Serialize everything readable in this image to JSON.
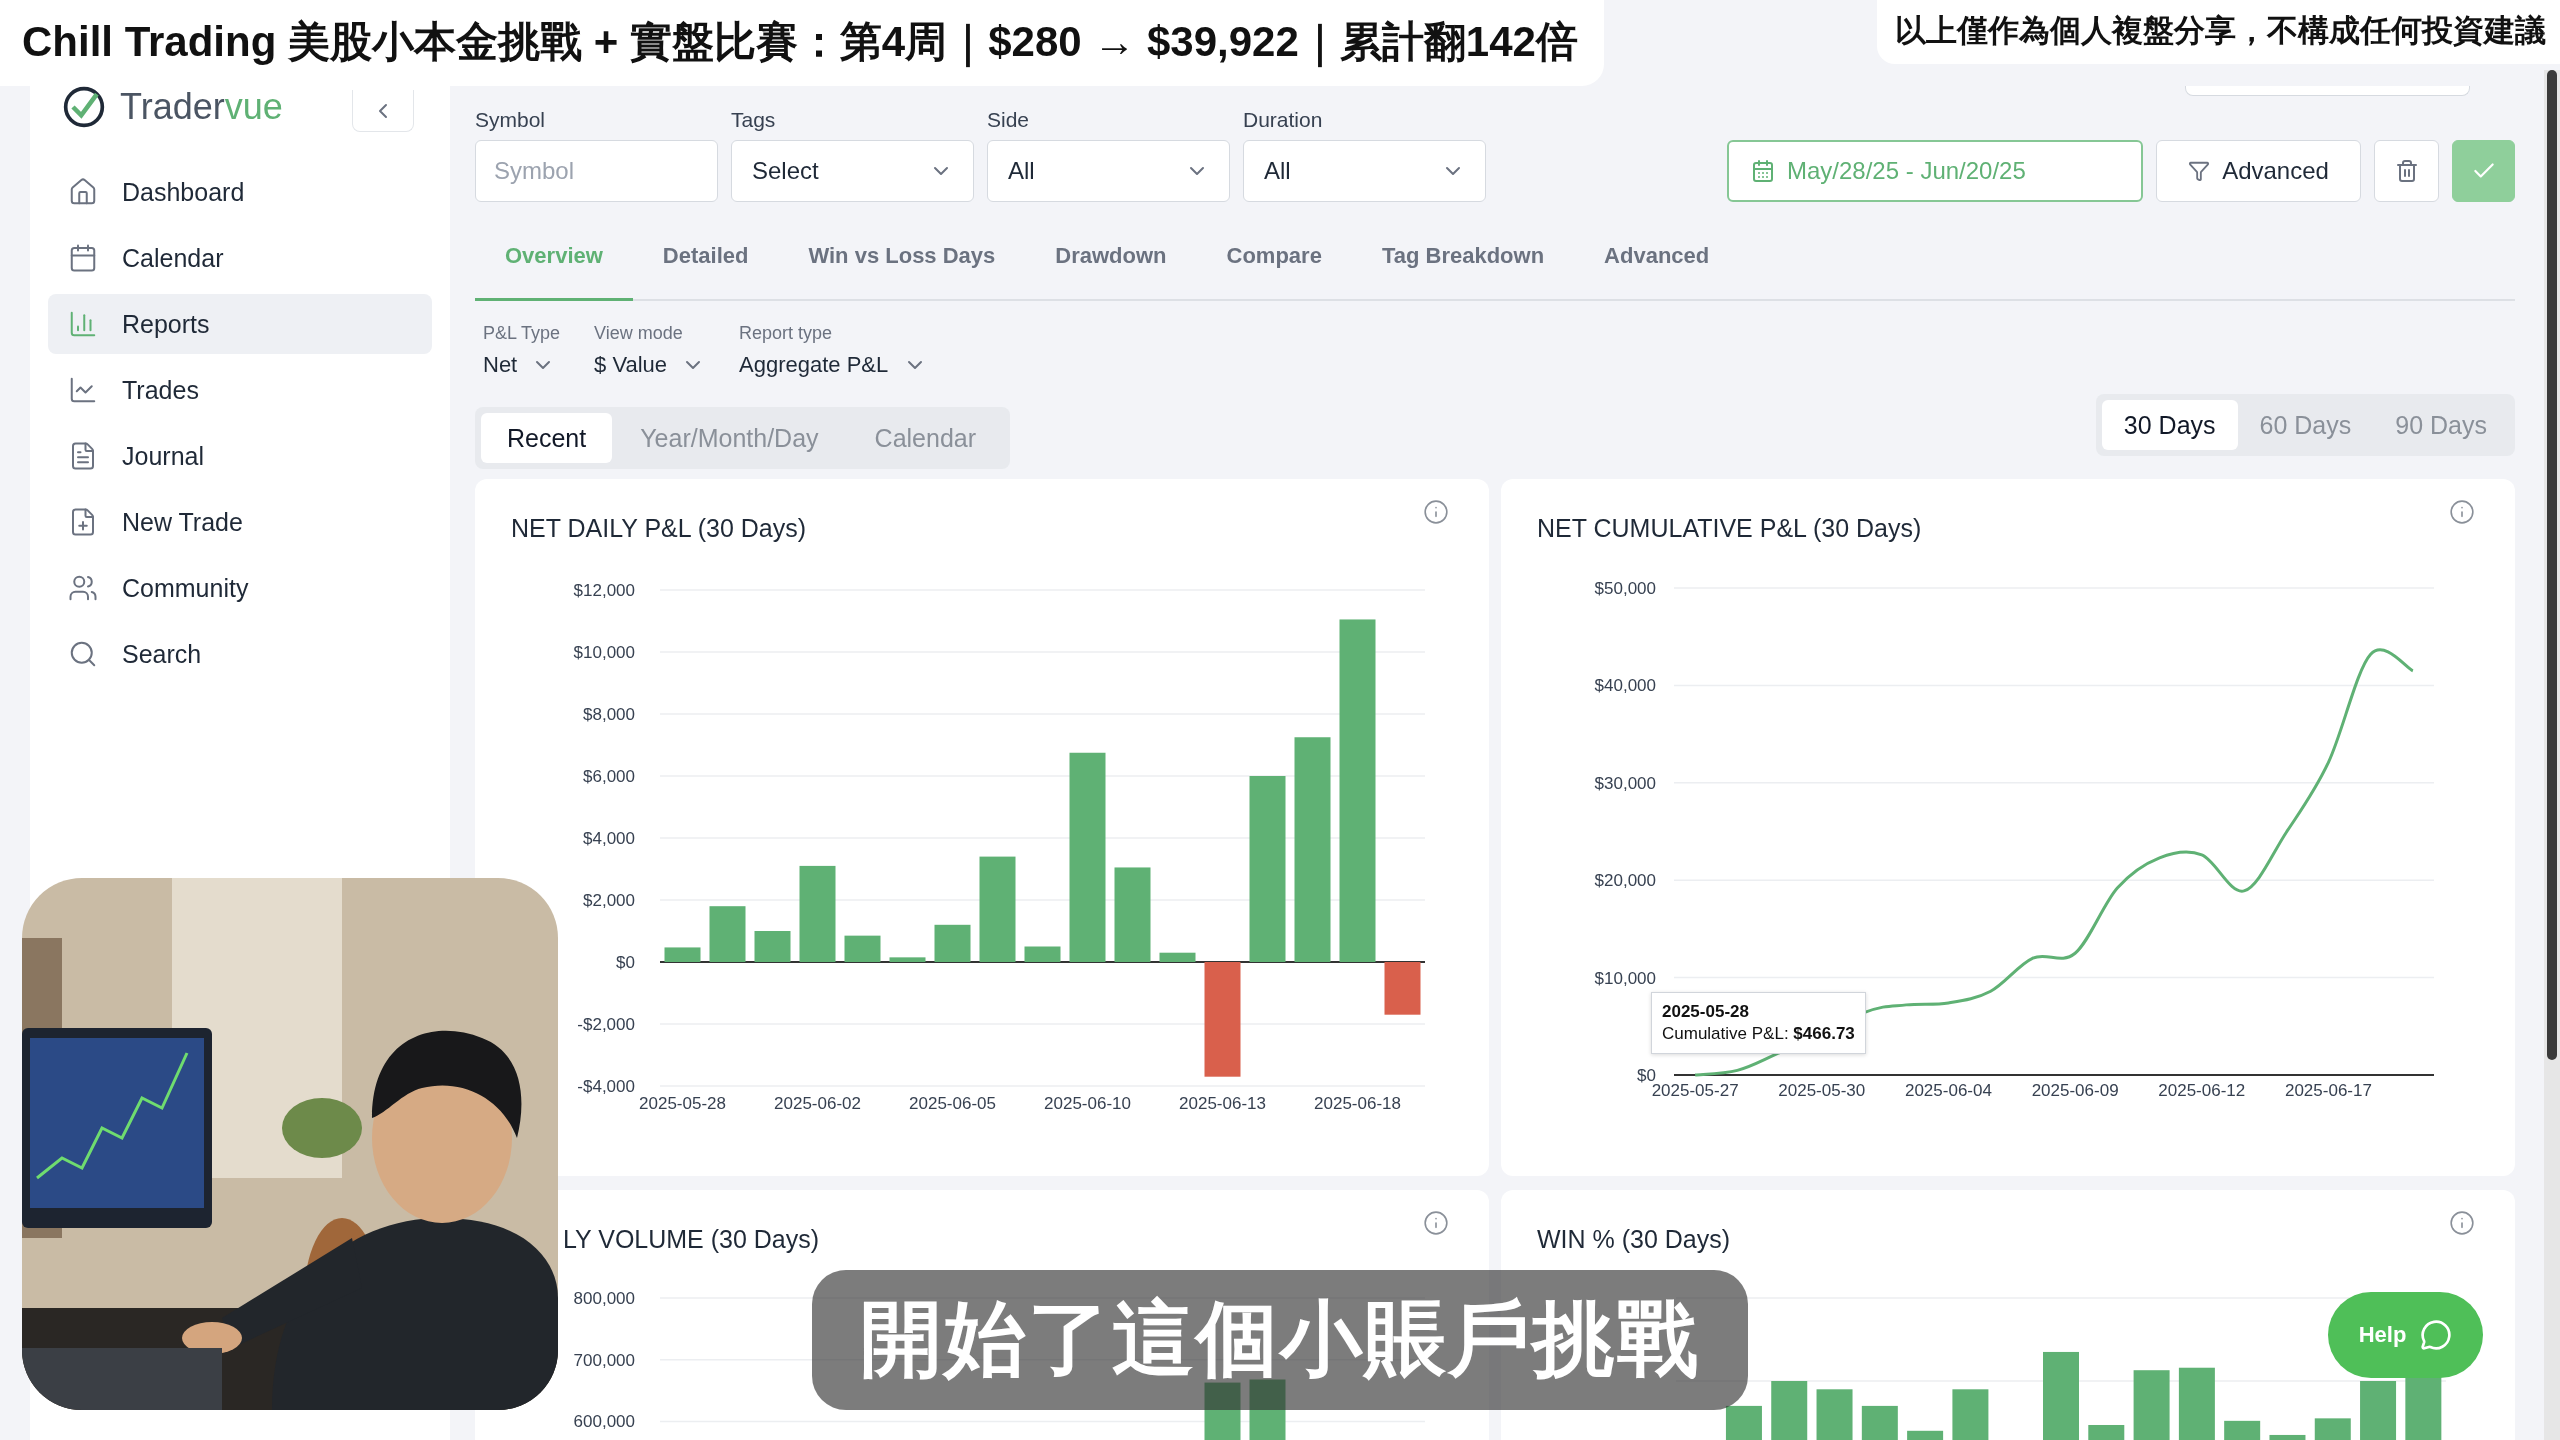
{
  "caption_banner": "Chill Trading 美股小本金挑戰 + 實盤比賽：第4周｜$280 → $39,922｜累計翻142倍",
  "disclaimer_banner": "以上僅作為個人複盤分享，不構成任何投資建議",
  "sidebar": {
    "logo": {
      "text": "Trader",
      "accent": "vue"
    },
    "items": [
      {
        "label": "Dashboard",
        "selected": false
      },
      {
        "label": "Calendar",
        "selected": false
      },
      {
        "label": "Reports",
        "selected": true
      },
      {
        "label": "Trades",
        "selected": false
      },
      {
        "label": "Journal",
        "selected": false
      },
      {
        "label": "New Trade",
        "selected": false
      },
      {
        "label": "Community",
        "selected": false
      },
      {
        "label": "Search",
        "selected": false
      }
    ]
  },
  "filters": [
    {
      "label": "Symbol",
      "kind": "input",
      "placeholder": "Symbol"
    },
    {
      "label": "Tags",
      "kind": "select",
      "value": "Select"
    },
    {
      "label": "Side",
      "kind": "select",
      "value": "All"
    },
    {
      "label": "Duration",
      "kind": "select",
      "value": "All"
    }
  ],
  "date_range": "May/28/25 - Jun/20/25",
  "advanced_button": "Advanced",
  "tabs": [
    {
      "label": "Overview",
      "selected": true
    },
    {
      "label": "Detailed",
      "selected": false
    },
    {
      "label": "Win vs Loss Days",
      "selected": false
    },
    {
      "label": "Drawdown",
      "selected": false
    },
    {
      "label": "Compare",
      "selected": false
    },
    {
      "label": "Tag Breakdown",
      "selected": false
    },
    {
      "label": "Advanced",
      "selected": false
    }
  ],
  "report_options": [
    {
      "label": "P&L Type",
      "value": "Net"
    },
    {
      "label": "View mode",
      "value": "$ Value"
    },
    {
      "label": "Report type",
      "value": "Aggregate P&L"
    }
  ],
  "view_tabs": [
    {
      "label": "Recent",
      "selected": true
    },
    {
      "label": "Year/Month/Day",
      "selected": false
    },
    {
      "label": "Calendar",
      "selected": false
    }
  ],
  "range_tabs": [
    {
      "label": "30 Days",
      "selected": true
    },
    {
      "label": "60 Days",
      "selected": false
    },
    {
      "label": "90 Days",
      "selected": false
    }
  ],
  "cards": [
    {
      "title": "NET DAILY P&L (30 Days)",
      "chart_data": {
        "type": "bar",
        "ylim": [
          -4000,
          12000
        ],
        "grid": true,
        "yticks": [
          {
            "value": -4000,
            "label": "-$4,000"
          },
          {
            "value": -2000,
            "label": "-$2,000"
          },
          {
            "value": 0,
            "label": "$0"
          },
          {
            "value": 2000,
            "label": "$2,000"
          },
          {
            "value": 4000,
            "label": "$4,000"
          },
          {
            "value": 6000,
            "label": "$6,000"
          },
          {
            "value": 8000,
            "label": "$8,000"
          },
          {
            "value": 10000,
            "label": "$10,000"
          },
          {
            "value": 12000,
            "label": "$12,000"
          }
        ],
        "values": [
          470,
          1800,
          1000,
          3100,
          850,
          150,
          1200,
          3400,
          500,
          6750,
          3050,
          300,
          -3700,
          6000,
          7250,
          11050,
          -1700
        ]
      },
      "date_labels": [
        "2025-05-28",
        "2025-06-02",
        "2025-06-05",
        "2025-06-10",
        "2025-06-13",
        "2025-06-18"
      ]
    },
    {
      "title": "NET CUMULATIVE P&L (30 Days)",
      "chart_data": {
        "type": "line",
        "ylim": [
          0,
          50000
        ],
        "grid": true,
        "yticks": [
          {
            "value": 0,
            "label": "$0"
          },
          {
            "value": 10000,
            "label": "$10,000"
          },
          {
            "value": 20000,
            "label": "$20,000"
          },
          {
            "value": 30000,
            "label": "$30,000"
          },
          {
            "value": 40000,
            "label": "$40,000"
          },
          {
            "value": 50000,
            "label": "$50,000"
          }
        ],
        "values": [
          0,
          470,
          2300,
          null,
          6400,
          7200,
          7400,
          8600,
          12000,
          12500,
          19200,
          22300,
          22600,
          18900,
          24900,
          32100,
          43200,
          41500
        ]
      },
      "date_labels": [
        "2025-05-27",
        "2025-05-30",
        "2025-06-04",
        "2025-06-09",
        "2025-06-12",
        "2025-06-17"
      ],
      "tooltip": {
        "date": "2025-05-28",
        "text": "Cumulative P&L: **$466.73**"
      }
    },
    {
      "title": "LY VOLUME (30 Days)",
      "chart_data": {
        "type": "bar",
        "ylim": [
          570000,
          800000
        ],
        "grid": true,
        "yticks": [
          {
            "value": 600000,
            "label": "600,000"
          },
          {
            "value": 700000,
            "label": "700,000"
          },
          {
            "value": 800000,
            "label": "800,000"
          }
        ],
        "values": [
          null,
          null,
          null,
          null,
          null,
          null,
          null,
          null,
          null,
          null,
          null,
          null,
          663000,
          668000,
          null,
          null,
          null
        ]
      }
    },
    {
      "title": "WIN % (30 Days)"
    }
  ],
  "subtitle": "開始了這個小賬戶挑戰",
  "help_button": "Help"
}
